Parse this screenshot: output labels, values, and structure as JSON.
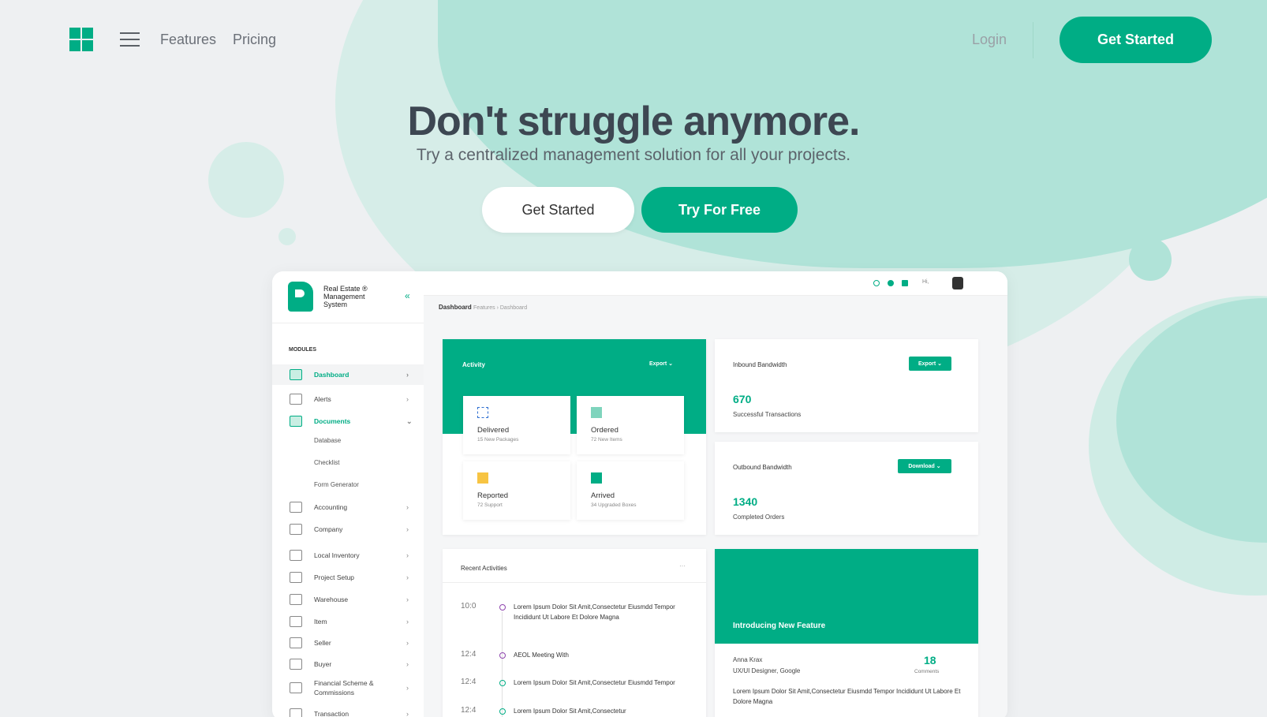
{
  "nav": {
    "features": "Features",
    "pricing": "Pricing",
    "login": "Login",
    "cta": "Get Started"
  },
  "hero": {
    "headline": "Don't struggle anymore.",
    "subline": "Try a centralized management solution for all your projects.",
    "primary_cta": "Get Started",
    "secondary_cta": "Try For Free"
  },
  "colors": {
    "accent": "#00ad85",
    "blob": "#b0e3d8",
    "background": "#eef0f2"
  },
  "dashboard": {
    "brand": "Real Estate ® Management System",
    "modules_label": "MODULES",
    "sidebar": [
      {
        "label": "Dashboard",
        "icon": "dashboard-icon"
      },
      {
        "label": "Alerts",
        "icon": "alert-icon"
      },
      {
        "label": "Documents",
        "icon": "document-icon"
      },
      {
        "label": "Accounting",
        "icon": "accounting-icon"
      },
      {
        "label": "Company",
        "icon": "company-icon"
      },
      {
        "label": "Local Inventory",
        "icon": "inventory-icon"
      },
      {
        "label": "Project Setup",
        "icon": "project-icon"
      },
      {
        "label": "Warehouse",
        "icon": "warehouse-icon"
      },
      {
        "label": "Item",
        "icon": "item-icon"
      },
      {
        "label": "Seller",
        "icon": "seller-icon"
      },
      {
        "label": "Buyer",
        "icon": "buyer-icon"
      },
      {
        "label": "Financial Scheme & Commissions",
        "icon": "finance-icon"
      },
      {
        "label": "Transaction",
        "icon": "transaction-icon"
      }
    ],
    "documents_sub": [
      "Database",
      "Checklist",
      "Form Generator"
    ],
    "topbar_hi": "Hi,",
    "breadcrumb": {
      "title": "Dashboard",
      "path": "Features › Dashboard"
    },
    "activity": {
      "title": "Activity",
      "export": "Export ⌄",
      "tiles": [
        {
          "title": "Delivered",
          "sub": "15 New Packages"
        },
        {
          "title": "Ordered",
          "sub": "72 New Items"
        },
        {
          "title": "Reported",
          "sub": "72 Support"
        },
        {
          "title": "Arrived",
          "sub": "34 Upgraded Boxes"
        }
      ]
    },
    "inbound": {
      "title": "Inbound Bandwidth",
      "button": "Export ⌄",
      "value": "670",
      "label": "Successful Transactions"
    },
    "outbound": {
      "title": "Outbound Bandwidth",
      "button": "Download ⌄",
      "value": "1340",
      "label": "Completed Orders"
    },
    "recent": {
      "title": "Recent Activities",
      "more": "···",
      "items": [
        {
          "time": "10:0",
          "text": "Lorem Ipsum Dolor Sit Amit,Consectetur Eiusmdd Tempor Incididunt Ut Labore Et Dolore Magna"
        },
        {
          "time": "12:4",
          "text": "AEOL Meeting With"
        },
        {
          "time": "12:4",
          "text": "Lorem Ipsum Dolor Sit Amit,Consectetur Eiusmdd Tempor"
        },
        {
          "time": "12:4",
          "text": "Lorem Ipsum Dolor Sit Amit,Consectetur"
        }
      ]
    },
    "feature": {
      "title": "Introducing New Feature",
      "author": "Anna Krax",
      "role": "UX/UI Designer, Google",
      "comments_count": "18",
      "comments_label": "Comments",
      "text": "Lorem Ipsum Dolor Sit Amit,Consectetur Eiusmdd Tempor Incididunt Ut Labore Et Dolore Magna"
    }
  }
}
